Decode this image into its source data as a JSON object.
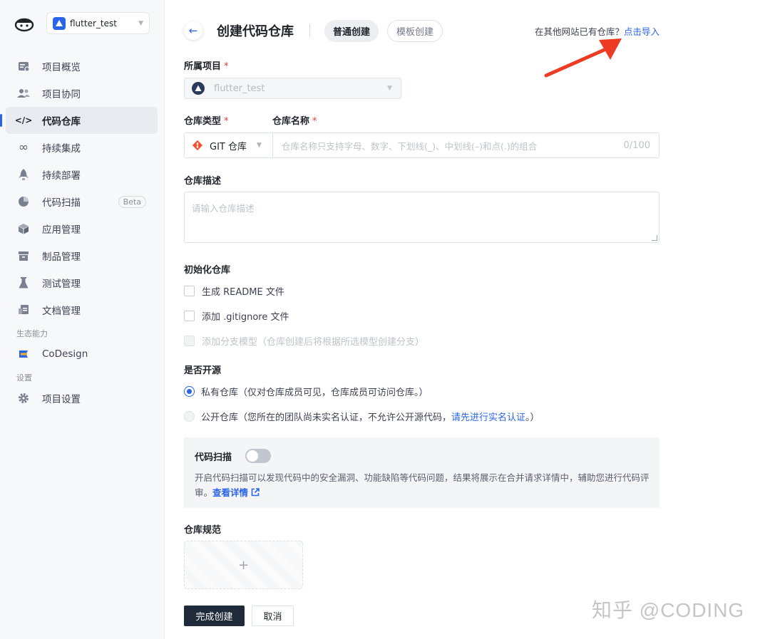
{
  "sidebar": {
    "project_name": "flutter_test",
    "items": [
      {
        "label": "项目概览",
        "icon": "dashboard-icon"
      },
      {
        "label": "项目协同",
        "icon": "users-icon"
      },
      {
        "label": "代码仓库",
        "icon": "code-icon",
        "active": true
      },
      {
        "label": "持续集成",
        "icon": "infinity-icon"
      },
      {
        "label": "持续部署",
        "icon": "rocket-icon"
      },
      {
        "label": "代码扫描",
        "icon": "pie-chart-icon",
        "badge": "Beta"
      },
      {
        "label": "应用管理",
        "icon": "cube-icon"
      },
      {
        "label": "制品管理",
        "icon": "archive-icon"
      },
      {
        "label": "测试管理",
        "icon": "flask-icon"
      },
      {
        "label": "文档管理",
        "icon": "document-icon"
      }
    ],
    "section_ecosystem": "生态能力",
    "codesign_label": "CoDesign",
    "section_settings": "设置",
    "settings_label": "项目设置"
  },
  "header": {
    "title": "创建代码仓库",
    "tab_normal": "普通创建",
    "tab_template": "模板创建",
    "import_prompt": "在其他网站已有仓库？",
    "import_link": "点击导入"
  },
  "form": {
    "project_label": "所属项目",
    "project_value": "flutter_test",
    "repo_type_label": "仓库类型",
    "repo_name_label": "仓库名称",
    "repo_type_value": "GIT 仓库",
    "repo_name_placeholder": "仓库名称只支持字母、数字、下划线(_)、中划线(–)和点(.)的组合",
    "repo_name_count": "0/100",
    "desc_label": "仓库描述",
    "desc_placeholder": "请输入仓库描述",
    "init_label": "初始化仓库",
    "init_readme": "生成 README 文件",
    "init_gitignore": "添加 .gitignore 文件",
    "init_branch": "添加分支模型（仓库创建后将根据所选模型创建分支）",
    "open_source_label": "是否开源",
    "private_label": "私有仓库（仅对仓库成员可见，仓库成员可访问仓库。）",
    "public_label": "公开仓库（您所在的团队尚未实名认证，不允许公开源代码，",
    "public_link": "请先进行实名认证",
    "public_suffix": "。）",
    "scan_label": "代码扫描",
    "scan_desc": "开启代码扫描可以发现代码中的安全漏洞、功能缺陷等代码问题，结果将展示在合并请求详情中，辅助您进行代码评审。",
    "scan_link": "查看详情",
    "spec_label": "仓库规范",
    "submit": "完成创建",
    "cancel": "取消"
  },
  "watermark": "知乎 @CODING",
  "colors": {
    "accent": "#2b64e8",
    "primary_button": "#1f2a3a",
    "required": "#e5383b",
    "arrow": "#ee3b24"
  }
}
